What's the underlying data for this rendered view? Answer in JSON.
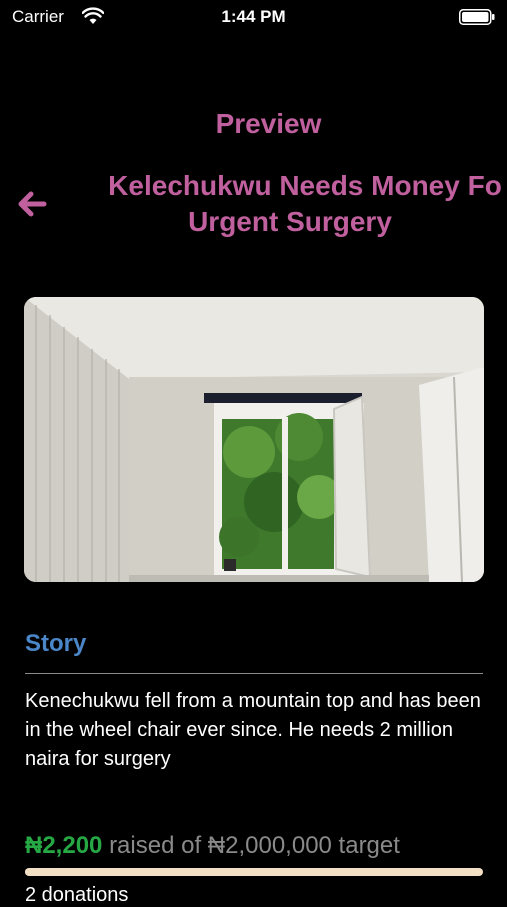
{
  "status_bar": {
    "carrier": "Carrier",
    "time": "1:44 PM"
  },
  "header": {
    "title": "Preview",
    "campaign_title_line1": "Kelechukwu Needs Money Fo",
    "campaign_title_line2": "Urgent Surgery",
    "back_icon": "arrow-left-icon"
  },
  "photo": {
    "alt": "Room with open window looking onto trees"
  },
  "story": {
    "heading": "Story",
    "text": "Kenechukwu fell from a mountain top and has been in the wheel chair ever since. He needs 2 million naira for surgery"
  },
  "funding": {
    "raised": "₦2,200",
    "raised_suffix": "raised of ₦2,000,000 target",
    "progress_fraction": 0.0011,
    "donations": "2 donations"
  },
  "colors": {
    "accent": "#c0609e",
    "story_heading": "#4a86c8",
    "raised": "#26a845",
    "progress": "#f3e0c4"
  }
}
